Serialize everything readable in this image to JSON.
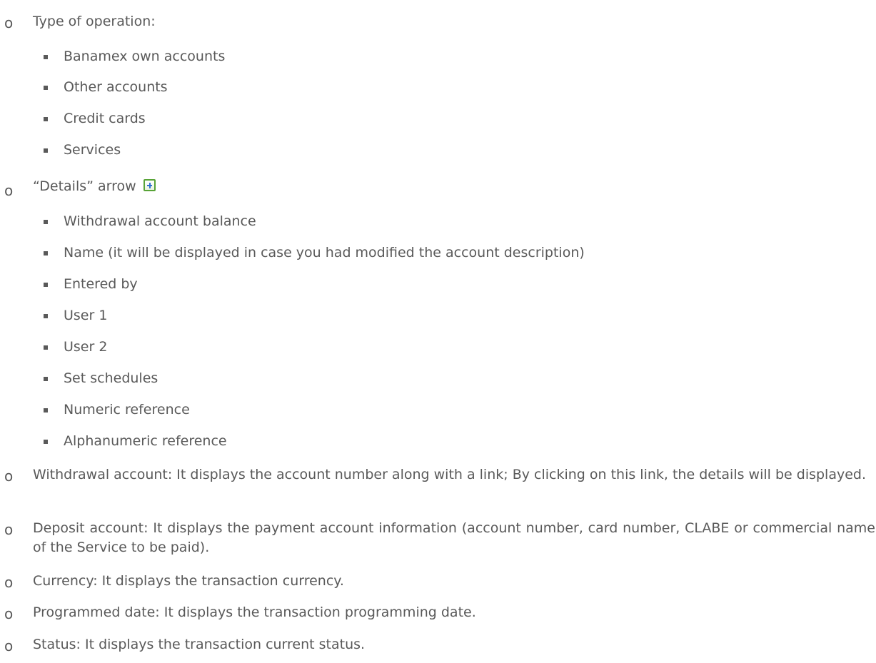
{
  "items": {
    "type_of_operation": {
      "label": "Type of operation:",
      "subitems": [
        "Banamex own accounts",
        "Other accounts",
        "Credit cards",
        "Services"
      ]
    },
    "details_arrow": {
      "label": "“Details” arrow",
      "icon": "plus-icon",
      "subitems": [
        "Withdrawal account balance",
        "Name (it will be displayed in case you had modified the account description)",
        "Entered by",
        "User 1",
        "User 2",
        "Set schedules",
        "Numeric reference",
        "Alphanumeric reference"
      ]
    },
    "withdrawal_account": "Withdrawal account: It displays the account number along with a link; By clicking on this link, the details will be displayed.",
    "deposit_account": "Deposit account: It displays the payment account information (account number, card number, CLABE or commercial name of the Service to be paid).",
    "currency": "Currency: It displays the transaction currency.",
    "programmed_date": "Programmed date: It displays the transaction programming date.",
    "status": "Status: It displays the transaction current status."
  },
  "colors": {
    "text": "#595959",
    "icon_border": "#58a337",
    "icon_plus": "#2f6fd0"
  }
}
